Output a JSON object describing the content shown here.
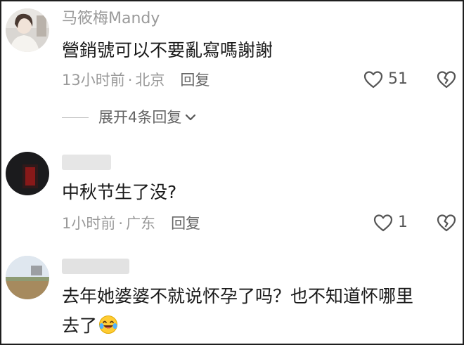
{
  "comments": [
    {
      "username": "马筱梅Mandy",
      "text": "營銷號可以不要亂寫嗎謝謝",
      "time": "13小时前",
      "location": "北京",
      "reply_label": "回复",
      "likes": "51",
      "expand_label": "展开4条回复"
    },
    {
      "username": "",
      "text": "中秋节生了没?",
      "time": "1小时前",
      "location": "广东",
      "reply_label": "回复",
      "likes": "1"
    },
    {
      "username": "",
      "text_line1": "去年她婆婆不就说怀孕了吗？也不知道怀哪里",
      "text_line2": "去了"
    }
  ],
  "meta_separator": "·",
  "icons": {
    "like": "heart-outline-icon",
    "dislike": "broken-heart-icon",
    "expand": "chevron-down-icon",
    "emoji": "laughing-tears-emoji-icon"
  },
  "colors": {
    "text": "#1a1a1a",
    "meta": "#9a9a9a",
    "border": "#1e1e1e"
  }
}
